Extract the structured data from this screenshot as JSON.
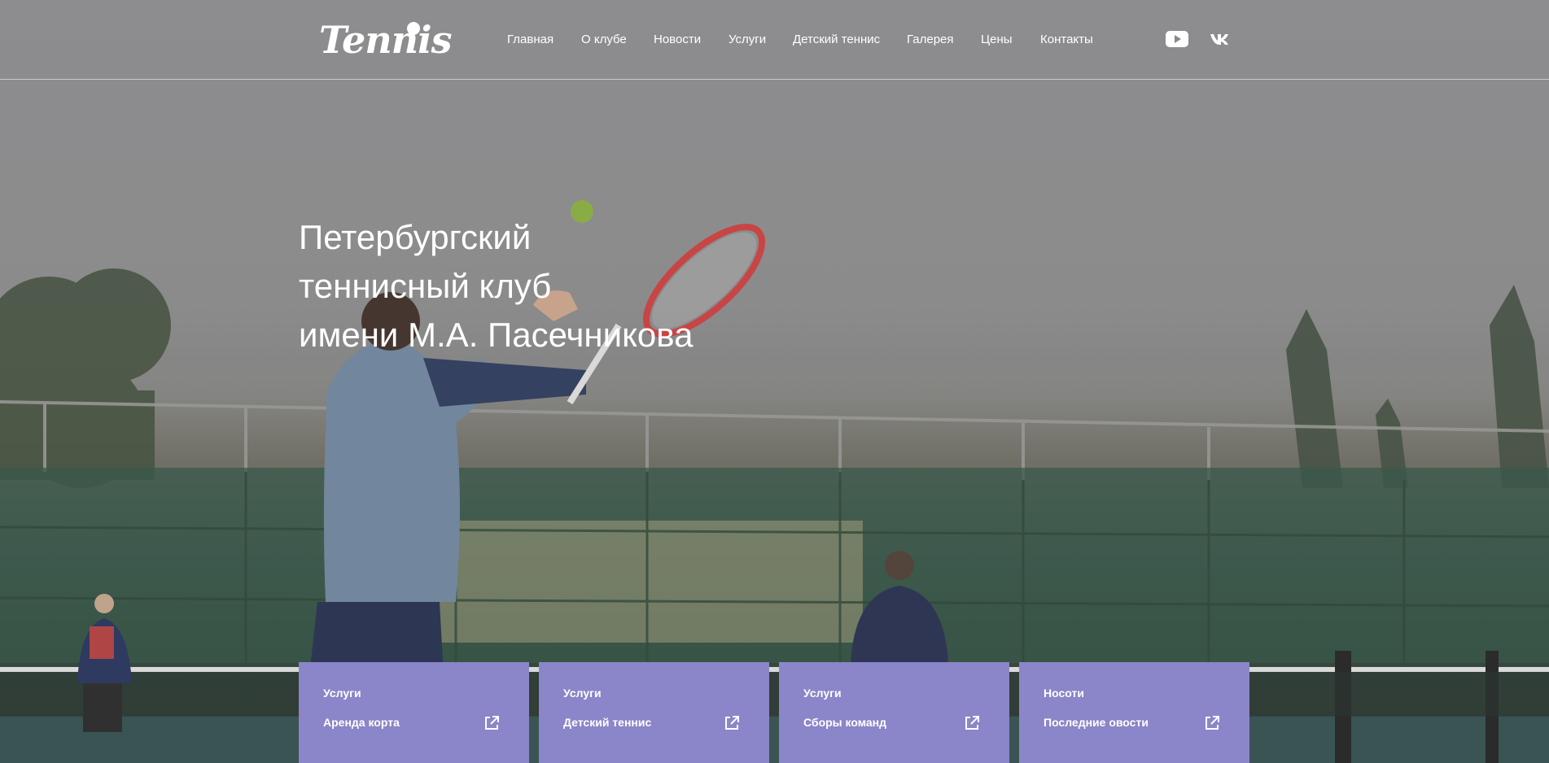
{
  "header": {
    "logo_text": "Tennis",
    "nav": [
      {
        "label": "Главная"
      },
      {
        "label": "О клубе"
      },
      {
        "label": "Новости"
      },
      {
        "label": "Услуги"
      },
      {
        "label": "Детский теннис"
      },
      {
        "label": "Галерея"
      },
      {
        "label": "Цены"
      },
      {
        "label": "Контакты"
      }
    ],
    "social": [
      {
        "icon": "youtube-icon"
      },
      {
        "icon": "vk-icon"
      }
    ]
  },
  "hero": {
    "title_lines": [
      "Петербургский",
      "теннисный клуб",
      "имени М.А. Пасечникова"
    ]
  },
  "cards": [
    {
      "category": "Услуги",
      "title": "Аренда корта",
      "icon": "external-link-icon"
    },
    {
      "category": "Услуги",
      "title": "Детский теннис",
      "icon": "external-link-icon"
    },
    {
      "category": "Услуги",
      "title": "Сборы команд",
      "icon": "external-link-icon"
    },
    {
      "category": "Носоти",
      "title": "Последние овости",
      "icon": "external-link-icon"
    }
  ],
  "colors": {
    "card_bg": "#8b85c9",
    "text": "#ffffff"
  }
}
